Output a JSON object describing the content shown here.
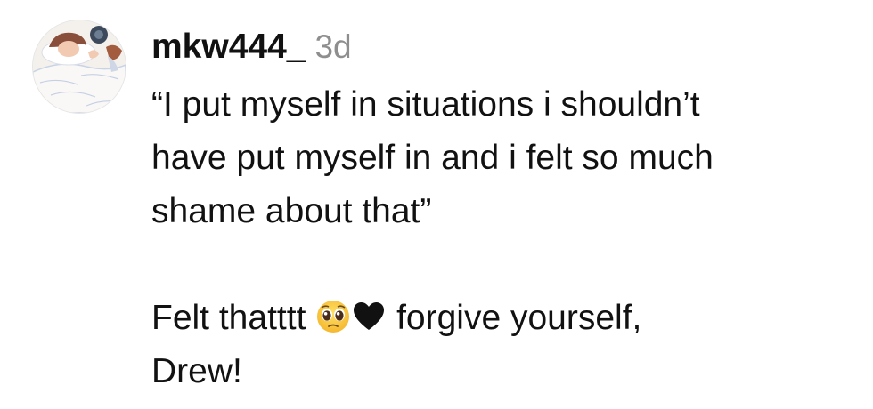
{
  "comment": {
    "username": "mkw444_",
    "timestamp": "3d",
    "quote_line_1": "“I put myself in situations i shouldn’t",
    "quote_line_2": "have put myself in and i felt so much",
    "quote_line_3": "shame about that”",
    "reply_prefix": "Felt thatttt",
    "reply_suffix": "forgive yourself,",
    "reply_line_2": "Drew!",
    "emojis": [
      "pleading-face-icon",
      "black-heart-icon"
    ]
  }
}
